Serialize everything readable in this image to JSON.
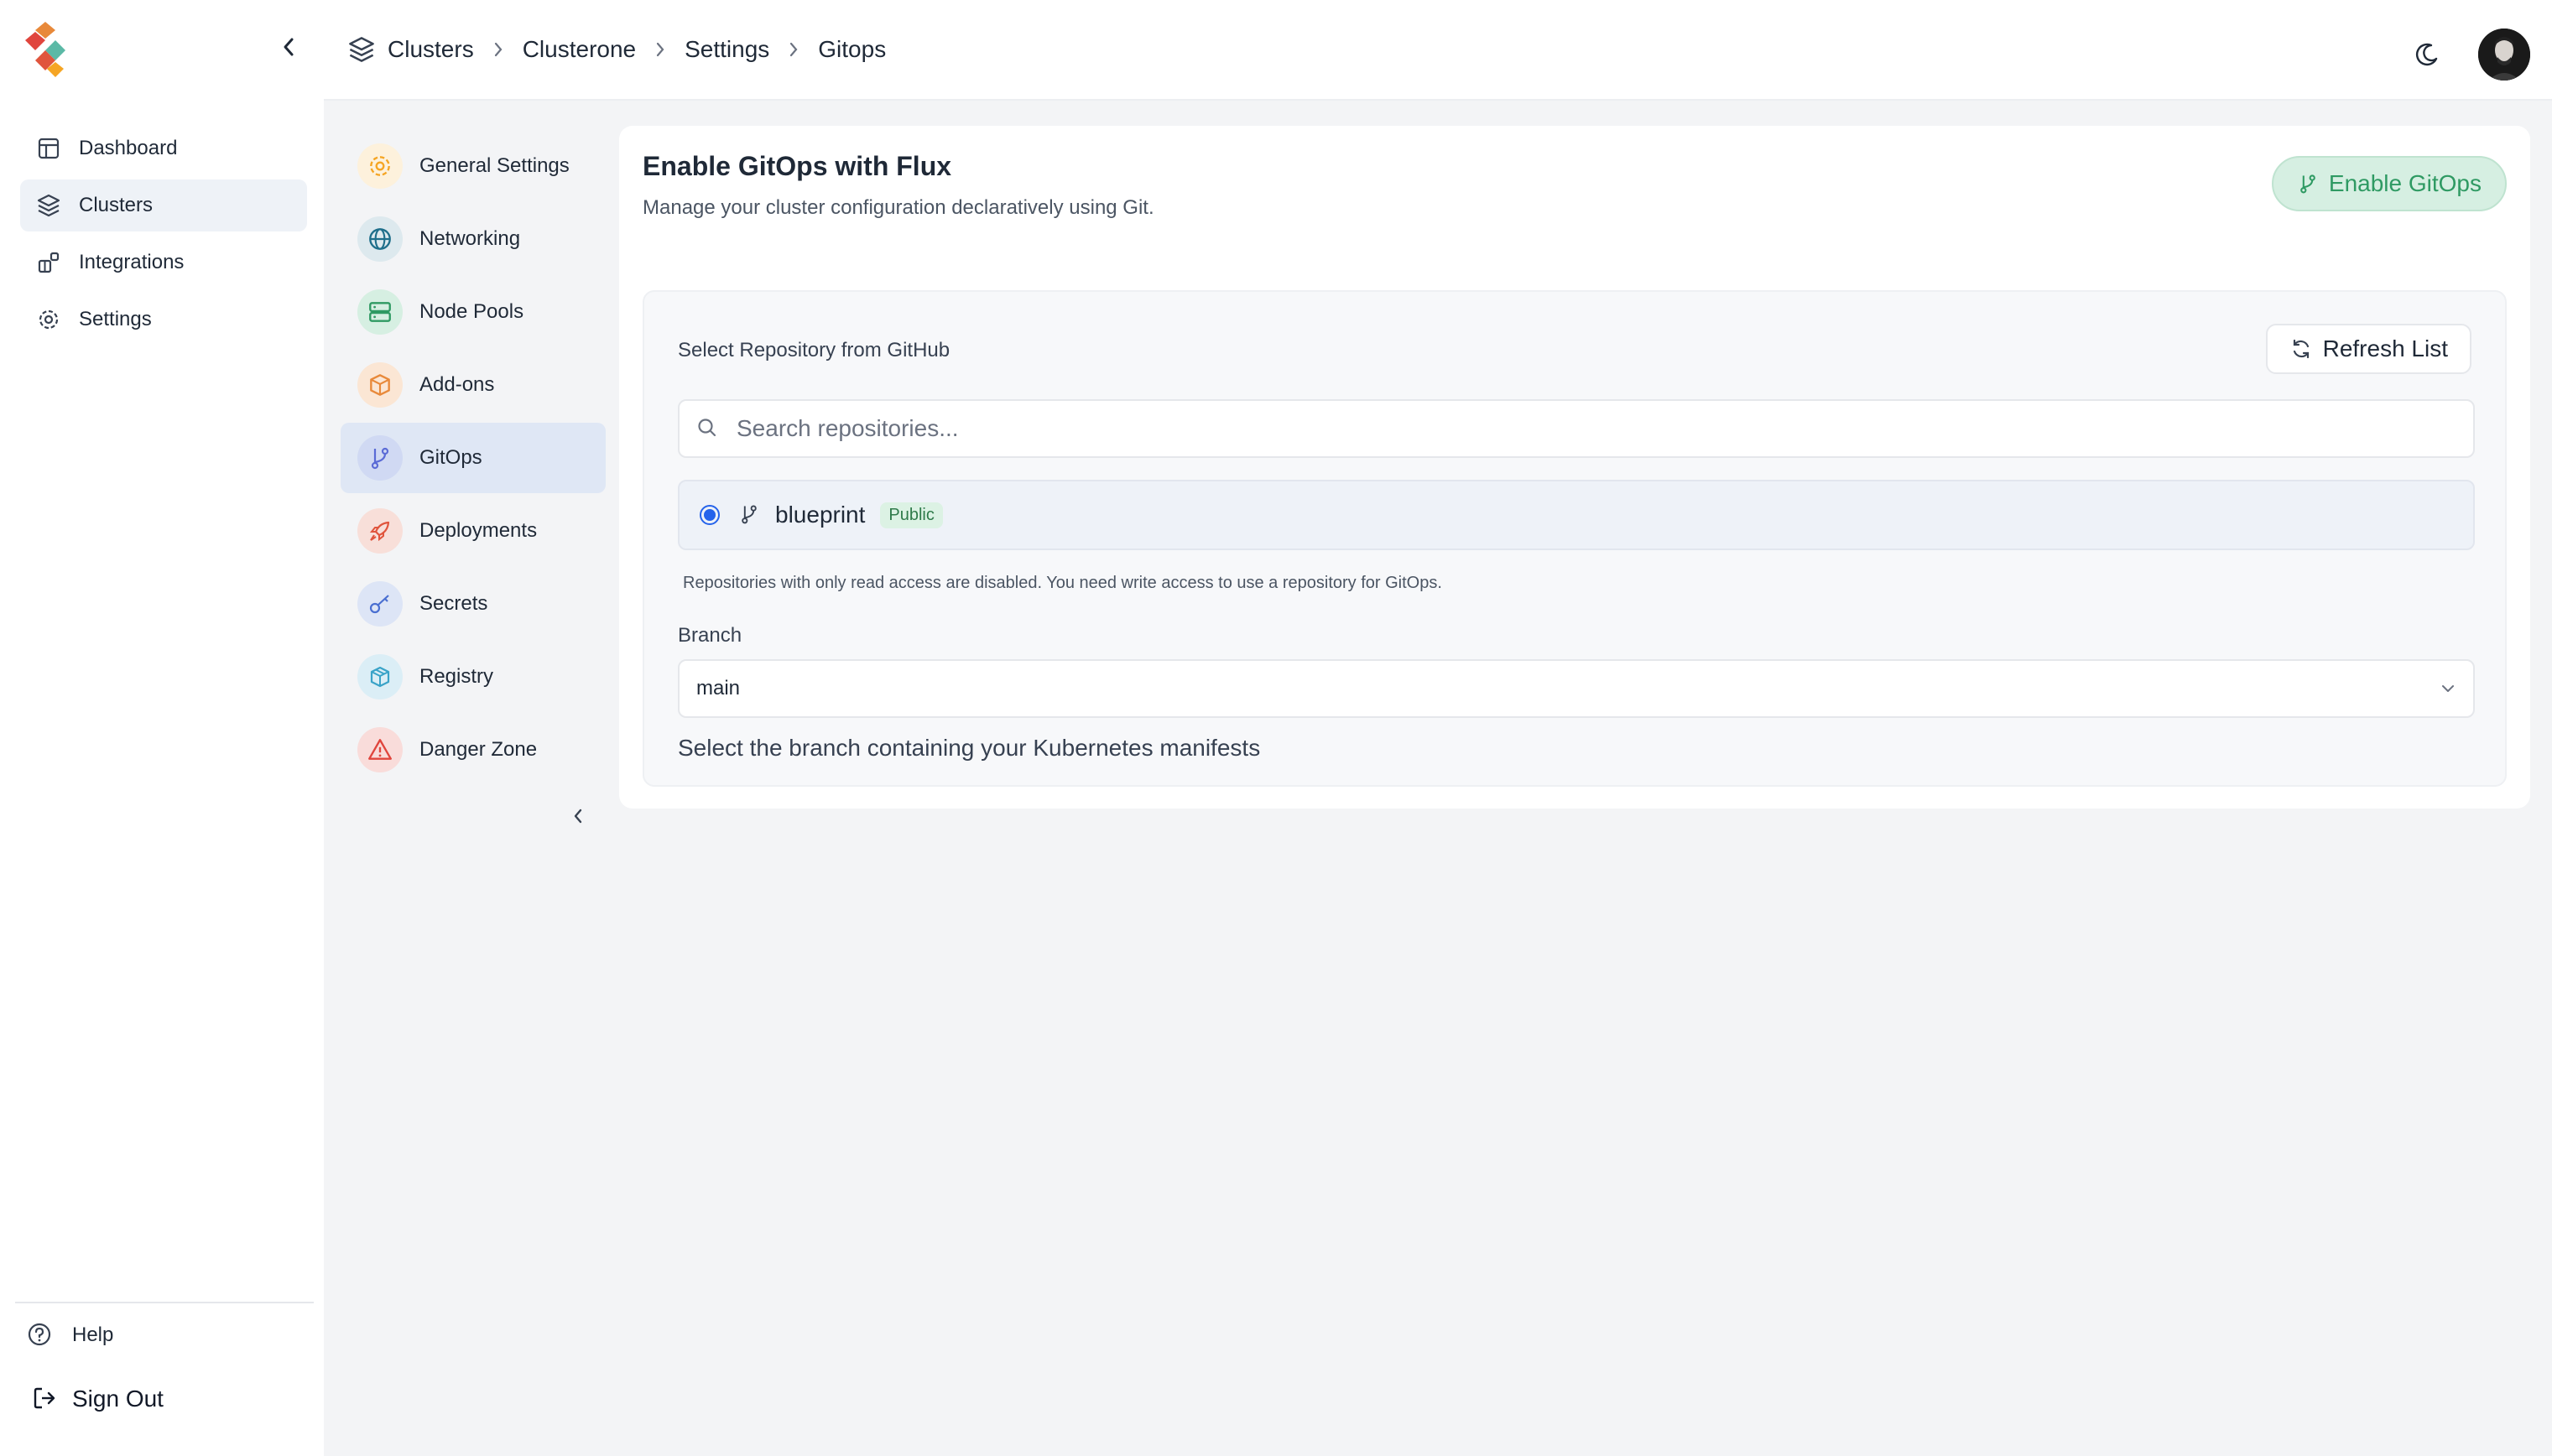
{
  "sidebar": {
    "items": [
      {
        "label": "Dashboard",
        "icon": "dashboard-icon"
      },
      {
        "label": "Clusters",
        "icon": "layers-icon",
        "active": true
      },
      {
        "label": "Integrations",
        "icon": "integrations-icon"
      },
      {
        "label": "Settings",
        "icon": "gear-icon"
      }
    ],
    "help_label": "Help",
    "signout_label": "Sign Out"
  },
  "breadcrumb": [
    "Clusters",
    "Clusterone",
    "Settings",
    "Gitops"
  ],
  "subnav": {
    "items": [
      {
        "label": "General Settings",
        "icon": "gear-icon",
        "color": "#f5a524",
        "bg": "#fdf1dc"
      },
      {
        "label": "Networking",
        "icon": "globe-icon",
        "color": "#1f6f8b",
        "bg": "#dde9ee"
      },
      {
        "label": "Node Pools",
        "icon": "server-icon",
        "color": "#2f9a63",
        "bg": "#d6efe2"
      },
      {
        "label": "Add-ons",
        "icon": "package-icon",
        "color": "#e8893a",
        "bg": "#fbe6d4"
      },
      {
        "label": "GitOps",
        "icon": "git-branch-icon",
        "color": "#5b6bd6",
        "bg": "#d0d9f3",
        "active": true
      },
      {
        "label": "Deployments",
        "icon": "rocket-icon",
        "color": "#e0553d",
        "bg": "#f8dfd9"
      },
      {
        "label": "Secrets",
        "icon": "key-icon",
        "color": "#4a6fd1",
        "bg": "#dde5f6"
      },
      {
        "label": "Registry",
        "icon": "box-icon",
        "color": "#3aa3c8",
        "bg": "#dbeef6"
      },
      {
        "label": "Danger Zone",
        "icon": "warning-icon",
        "color": "#e0453d",
        "bg": "#f9dcda"
      }
    ]
  },
  "card": {
    "title": "Enable GitOps with Flux",
    "subtitle": "Manage your cluster configuration declaratively using Git.",
    "enable_button": "Enable GitOps",
    "repo_section_label": "Select Repository from GitHub",
    "refresh_button": "Refresh List",
    "search_placeholder": "Search repositories...",
    "repo": {
      "name": "blueprint",
      "visibility": "Public",
      "selected": true
    },
    "note": "Repositories with only read access are disabled. You need write access to use a repository for GitOps.",
    "branch_label": "Branch",
    "branch_value": "main",
    "branch_help": "Select the branch containing your Kubernetes manifests"
  },
  "colors": {
    "accent": "#2f9a63",
    "radio": "#2563eb"
  }
}
